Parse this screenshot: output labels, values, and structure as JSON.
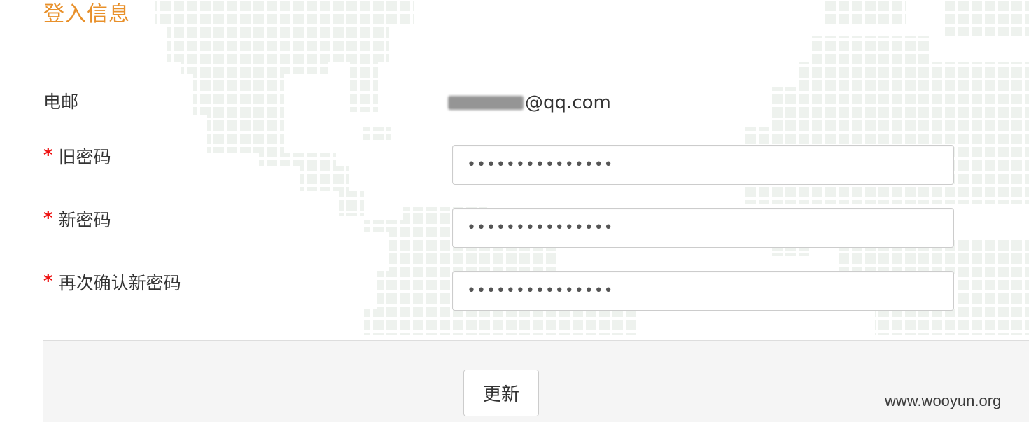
{
  "section": {
    "title": "登入信息"
  },
  "form": {
    "email_label": "电邮",
    "email_domain": "@qq.com",
    "required_mark": "*",
    "old_password_label": "旧密码",
    "old_password_value": "•••••••••••••••",
    "new_password_label": "新密码",
    "new_password_value": "•••••••••••••••",
    "confirm_password_label": "再次确认新密码",
    "confirm_password_value": "•••••••••••••••"
  },
  "actions": {
    "update_label": "更新"
  },
  "watermark": {
    "text": "www.wooyun.org"
  },
  "colors": {
    "title": "#e8902a",
    "required": "#ee1111",
    "map_dots": "#eef2ee"
  }
}
